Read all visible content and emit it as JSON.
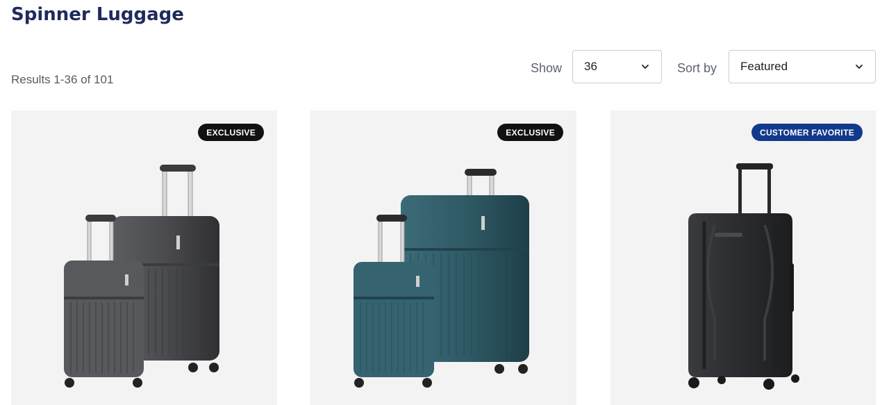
{
  "page": {
    "title": "Spinner Luggage",
    "results": "Results 1-36 of 101"
  },
  "controls": {
    "show_label": "Show",
    "show_value": "36",
    "sort_label": "Sort by",
    "sort_value": "Featured"
  },
  "products": [
    {
      "badge": "EXCLUSIVE",
      "badge_color": "#111111",
      "image": "two-piece-gray-hardside-spinner-set",
      "shell_color": "#4a4b4e"
    },
    {
      "badge": "EXCLUSIVE",
      "badge_color": "#111111",
      "image": "two-piece-teal-hardside-spinner-set",
      "shell_color": "#2f5a66"
    },
    {
      "badge": "CUSTOMER FAVORITE",
      "badge_color": "#123a8c",
      "image": "single-black-hardside-spinner",
      "shell_color": "#2c2d30"
    }
  ],
  "colors": {
    "title": "#1f2a5c",
    "card_bg": "#f3f3f3",
    "border": "#c9ccd2"
  }
}
